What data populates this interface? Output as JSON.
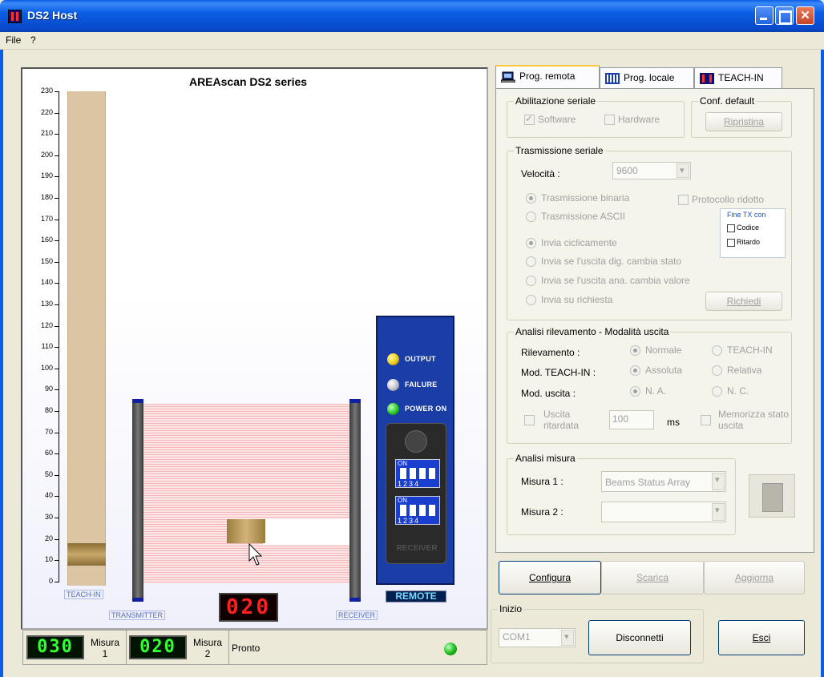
{
  "window": {
    "title": "DS2 Host"
  },
  "menu": {
    "items": [
      "File",
      "?"
    ]
  },
  "sim": {
    "title": "AREAscan DS2 series",
    "scale_labels": [
      "230",
      "220",
      "210",
      "200",
      "190",
      "180",
      "170",
      "160",
      "150",
      "140",
      "130",
      "120",
      "110",
      "100",
      "90",
      "80",
      "70",
      "60",
      "50",
      "40",
      "30",
      "20",
      "10",
      "0"
    ],
    "teach_label": "TEACH-IN",
    "transmitter_label": "TRANSMITTER",
    "receiver_label": "RECEIVER",
    "center_display": "020",
    "status_output": "OUTPUT",
    "status_failure": "FAILURE",
    "status_power": "POWER ON",
    "dip_on": "ON",
    "dip_numbers": "1234",
    "receiver_box_label": "RECEIVER",
    "remote_label": "REMOTE",
    "colors": {
      "output_led": "#f0d020",
      "failure_led": "#c8c8d0",
      "power_led": "#30d030"
    }
  },
  "statusbar": {
    "measure1_value": "030",
    "measure1_label": "Misura 1",
    "measure2_value": "020",
    "measure2_label": "Misura 2",
    "status_text": "Pronto"
  },
  "tabs": [
    {
      "label": "Prog. remota",
      "icon": "computer-icon"
    },
    {
      "label": "Prog. locale",
      "icon": "bars-icon"
    },
    {
      "label": "TEACH-IN",
      "icon": "teach-icon"
    }
  ],
  "serial_enable": {
    "title": "Abilitazione seriale",
    "software": "Software",
    "hardware": "Hardware"
  },
  "conf_default": {
    "title": "Conf. default",
    "button": "Ripristina"
  },
  "serial_tx": {
    "title": "Trasmissione seriale",
    "speed_label": "Velocità :",
    "speed_value": "9600",
    "binary": "Trasmissione binaria",
    "ascii": "Trasmissione ASCII",
    "reduced_protocol": "Protocollo ridotto",
    "fine_tx_title": "Fine TX con",
    "fine_code": "Codice",
    "fine_delay": "Ritardo",
    "cyclic": "Invia ciclicamente",
    "on_digital_change": "Invia se l'uscita dig. cambia stato",
    "on_analog_change": "Invia se l'uscita ana. cambia valore",
    "on_request": "Invia su richiesta",
    "request_button": "Richiedi"
  },
  "analysis": {
    "title": "Analisi rilevamento - Modalità uscita",
    "detection_label": "Rilevamento :",
    "detection_normal": "Normale",
    "detection_teach": "TEACH-IN",
    "teach_mode_label": "Mod. TEACH-IN :",
    "teach_absolute": "Assoluta",
    "teach_relative": "Relativa",
    "output_mode_label": "Mod. uscita :",
    "output_na": "N. A.",
    "output_nc": "N. C.",
    "delayed_output": "Uscita ritardata",
    "delay_value": "100",
    "delay_unit": "ms",
    "store_state": "Memorizza stato uscita"
  },
  "measure": {
    "title": "Analisi misura",
    "m1_label": "Misura 1 :",
    "m1_value": "Beams Status Array",
    "m2_label": "Misura 2 :",
    "m2_value": ""
  },
  "actions": {
    "configure": "Configura",
    "download": "Scarica",
    "update": "Aggiorna"
  },
  "start": {
    "title": "Inizio",
    "port": "COM1",
    "disconnect": "Disconnetti",
    "exit": "Esci"
  }
}
